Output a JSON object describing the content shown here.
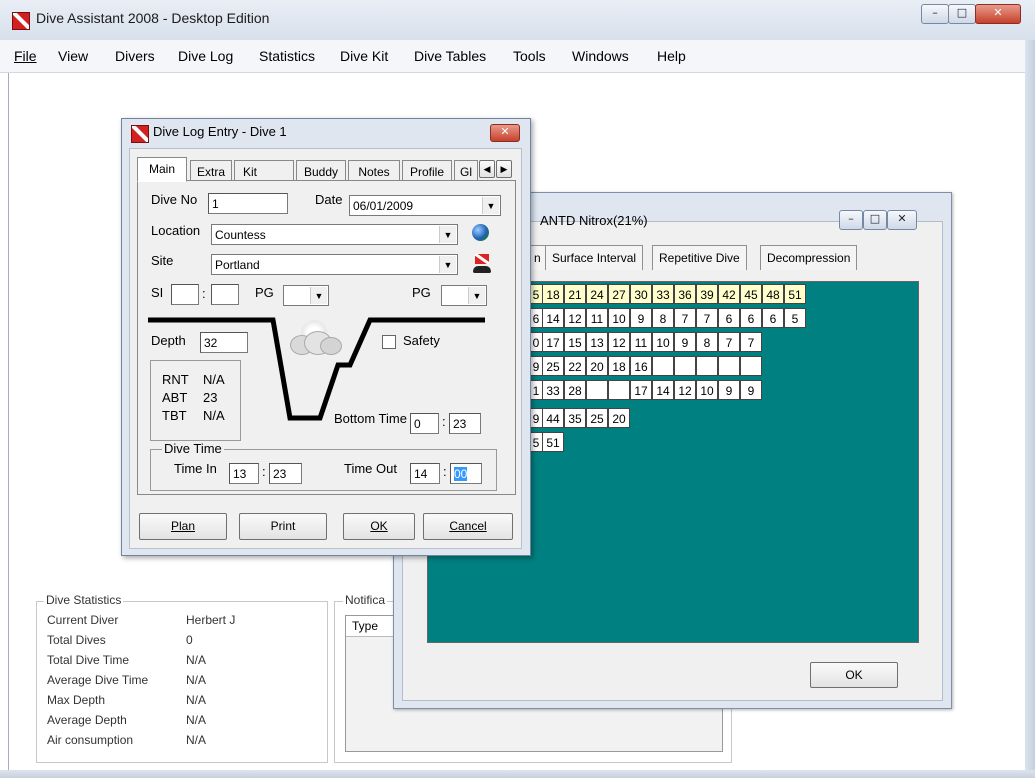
{
  "app": {
    "title": "Dive Assistant 2008 - Desktop Edition",
    "menu": [
      "File",
      "View",
      "Divers",
      "Dive Log",
      "Statistics",
      "Dive Kit",
      "Dive Tables",
      "Tools",
      "Windows",
      "Help"
    ]
  },
  "stats": {
    "legend": "Dive Statistics",
    "rows": [
      {
        "label": "Current Diver",
        "value": "Herbert J"
      },
      {
        "label": "Total Dives",
        "value": "0"
      },
      {
        "label": "Total Dive Time",
        "value": "N/A"
      },
      {
        "label": "Average Dive Time",
        "value": "N/A"
      },
      {
        "label": "Max Depth",
        "value": "N/A"
      },
      {
        "label": "Average Depth",
        "value": "N/A"
      },
      {
        "label": "Air consumption",
        "value": "N/A"
      }
    ]
  },
  "notifications": {
    "legend": "Notifica",
    "col_type": "Type"
  },
  "tables_window": {
    "title": "ANTD Nitrox(21%)",
    "tabs": [
      "n",
      "Surface Interval",
      "Repetitive Dive",
      "Decompression"
    ],
    "ok_label": "OK",
    "rows": [
      [
        "5",
        "18",
        "21",
        "24",
        "27",
        "30",
        "33",
        "36",
        "39",
        "42",
        "45",
        "48",
        "51"
      ],
      [
        "6",
        "14",
        "12",
        "11",
        "10",
        "9",
        "8",
        "7",
        "7",
        "6",
        "6",
        "6",
        "5"
      ],
      [
        "0",
        "17",
        "15",
        "13",
        "12",
        "11",
        "10",
        "9",
        "8",
        "7",
        "7"
      ],
      [
        "9",
        "25",
        "22",
        "20",
        "18",
        "16",
        "",
        "",
        "",
        "",
        ""
      ],
      [
        "1",
        "33",
        "28",
        "",
        "",
        "17",
        "14",
        "12",
        "10",
        "9",
        "9"
      ],
      [
        "9",
        "44",
        "35",
        "25",
        "20"
      ],
      [
        "5",
        "51"
      ]
    ]
  },
  "dive_log": {
    "title": "Dive Log Entry - Dive 1",
    "tabs": [
      "Main",
      "Extra",
      "Kit",
      "Buddy",
      "Notes",
      "Profile",
      "Gl"
    ],
    "dive_no_label": "Dive No",
    "dive_no": "1",
    "date_label": "Date",
    "date": "06/01/2009",
    "location_label": "Location",
    "location": "Countess",
    "site_label": "Site",
    "site": "Portland",
    "si_label": "SI",
    "si_sep": ":",
    "pg_label_start": "PG",
    "pg_label_end": "PG",
    "depth_label": "Depth",
    "depth": "32",
    "safety_label": "Safety",
    "rnt_label": "RNT",
    "rnt": "N/A",
    "abt_label": "ABT",
    "abt": "23",
    "tbt_label": "TBT",
    "tbt": "N/A",
    "bottom_time_label": "Bottom Time",
    "bottom_time_h": "0",
    "bottom_time_m": "23",
    "dive_time_legend": "Dive Time",
    "time_in_label": "Time In",
    "time_in_h": "13",
    "time_in_m": "23",
    "time_out_label": "Time Out",
    "time_out_h": "14",
    "time_out_m": "00",
    "buttons": {
      "plan": "Plan",
      "print": "Print",
      "ok": "OK",
      "cancel": "Cancel"
    }
  }
}
